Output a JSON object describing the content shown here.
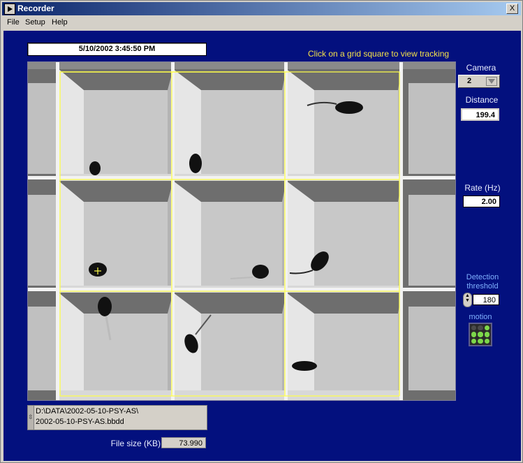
{
  "window": {
    "title": "Recorder",
    "close_label": "X"
  },
  "menu": [
    "File",
    "Setup",
    "Help"
  ],
  "datetime": "5/10/2002  3:45:50 PM",
  "hint": "Click on a grid square to view tracking",
  "camera": {
    "label": "Camera",
    "value": "2"
  },
  "distance": {
    "label": "Distance",
    "value": "199.4"
  },
  "rate": {
    "label": "Rate (Hz)",
    "value": "2.00"
  },
  "threshold": {
    "label_line1": "Detection",
    "label_line2": "threshold",
    "value": "180"
  },
  "motion": {
    "label": "motion",
    "leds": [
      "off",
      "off",
      "on",
      "on",
      "on",
      "on",
      "on",
      "on",
      "on"
    ],
    "on_color": "#7dd84a",
    "off_color": "#4a4a4a"
  },
  "file": {
    "path_line1": "D:\\DATA\\2002-05-10-PSY-AS\\",
    "path_line2": "2002-05-10-PSY-AS.bbdd"
  },
  "filesize": {
    "label": "File size (KB)",
    "value": "73.990"
  },
  "colors": {
    "panel": "#03107e",
    "hint": "#f4e04a",
    "grid": "#ffff4a"
  }
}
